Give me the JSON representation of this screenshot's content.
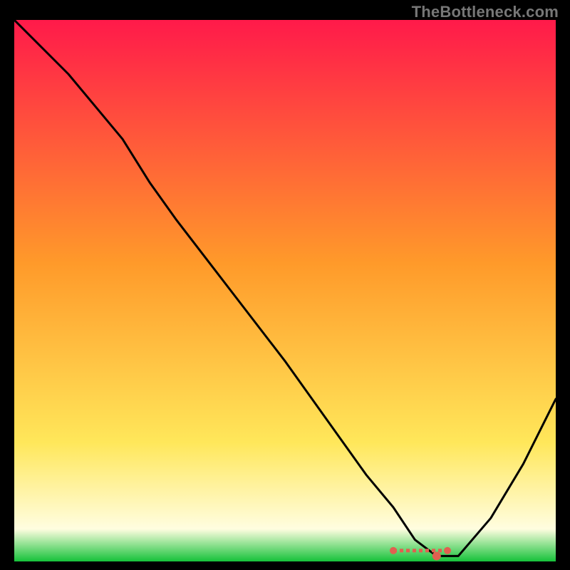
{
  "watermark": "TheBottleneck.com",
  "colors": {
    "background": "#000000",
    "gradient_top": "#ff1a4a",
    "gradient_mid": "#ff9a2a",
    "gradient_low": "#ffe75a",
    "gradient_base_light": "#fffde0",
    "gradient_base": "#16c23a",
    "curve": "#000000",
    "marker": "#e06050"
  },
  "chart_data": {
    "type": "line",
    "title": "",
    "xlabel": "",
    "ylabel": "",
    "xlim": [
      0,
      100
    ],
    "ylim": [
      0,
      100
    ],
    "series": [
      {
        "name": "bottleneck-curve",
        "x": [
          0,
          10,
          20,
          25,
          30,
          40,
          50,
          60,
          65,
          70,
          74,
          78,
          82,
          88,
          94,
          100
        ],
        "y": [
          100,
          90,
          78,
          70,
          63,
          50,
          37,
          23,
          16,
          10,
          4,
          1,
          1,
          8,
          18,
          30
        ]
      }
    ],
    "markers": [
      {
        "name": "range-left",
        "x": 70,
        "y": 2
      },
      {
        "name": "range-right",
        "x": 80,
        "y": 2
      }
    ],
    "optimum_x": 78
  }
}
